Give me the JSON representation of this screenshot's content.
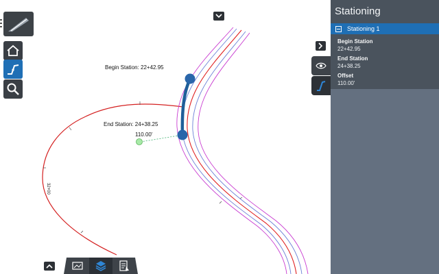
{
  "panel": {
    "title": "Stationing",
    "item_label": "Stationing 1",
    "begin_station_label": "Begin Station",
    "begin_station_value": "22+42.95",
    "end_station_label": "End Station",
    "end_station_value": "24+38.25",
    "offset_label": "Offset",
    "offset_value": "110.00'"
  },
  "map": {
    "begin_annotation": "Begin Station: 22+42.95",
    "end_annotation": "End Station: 24+38.25",
    "offset_annotation": "110.00'",
    "station_tick_label": "32+00"
  },
  "toolbar": {
    "buttons": [
      "road-model-icon",
      "home-icon",
      "alignment-icon",
      "search-icon"
    ]
  },
  "bottom_tabs": [
    "image-icon",
    "layers-icon",
    "report-icon"
  ],
  "colors": {
    "accent": "#1f6fb5",
    "panel_bg": "#647080",
    "panel_header": "#4a535d",
    "alignment_red": "#e02020",
    "edge_magenta": "#d040d0",
    "lane_blue": "#6a7fd6"
  }
}
